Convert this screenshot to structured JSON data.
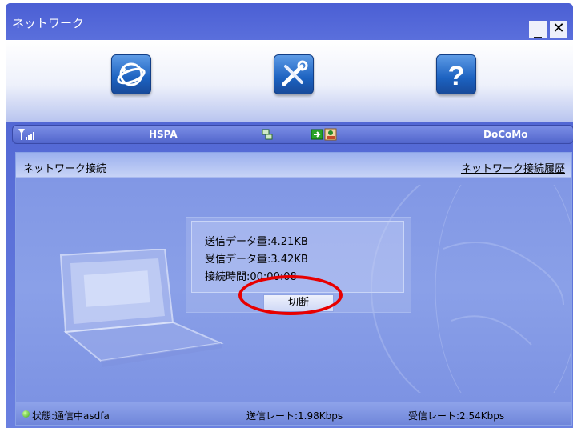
{
  "window": {
    "title": "ネットワーク",
    "minimize_label": "_",
    "close_label": "✕"
  },
  "toolbar": {
    "buttons": [
      {
        "name": "network-button",
        "icon": "globe-network-icon"
      },
      {
        "name": "settings-button",
        "icon": "tools-icon"
      },
      {
        "name": "help-button",
        "icon": "question-mark-icon",
        "glyph": "?"
      }
    ]
  },
  "statusbar": {
    "signal_icon": "signal-strength-icon",
    "network_type": "HSPA",
    "connection_icon": "connection-status-icon",
    "sms_icon": "sms-icon",
    "contacts_icon": "contacts-icon",
    "carrier": "DoCoMo"
  },
  "panel": {
    "title": "ネットワーク接続",
    "history_link": "ネットワーク接続履歴"
  },
  "info": {
    "sent": "送信データ量:4.21KB",
    "received": "受信データ量:3.42KB",
    "time": "接続時間:00:00:08",
    "disconnect_label": "切断"
  },
  "footer": {
    "status": "状態:通信中asdfa",
    "send_rate": "送信レート:1.98Kbps",
    "recv_rate": "受信レート:2.54Kbps"
  },
  "colors": {
    "window_blue": "#4b5fd4",
    "highlight_ring": "#e80000",
    "status_green": "#3aa51a"
  }
}
